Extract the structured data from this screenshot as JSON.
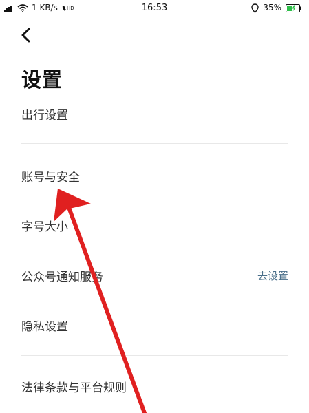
{
  "status_bar": {
    "network": "1 KB/s",
    "hd_label": "HD",
    "time": "16:53",
    "battery": "35%"
  },
  "header": {
    "title": "设置"
  },
  "settings": {
    "travel": "出行设置",
    "account_security": "账号与安全",
    "font_size": "字号大小",
    "official_account": "公众号通知服务",
    "official_account_action": "去设置",
    "privacy": "隐私设置",
    "legal": "法律条款与平台规则"
  },
  "colors": {
    "arrow": "#e02020",
    "link": "#4a6f8a",
    "divider": "#e8e8e8"
  }
}
